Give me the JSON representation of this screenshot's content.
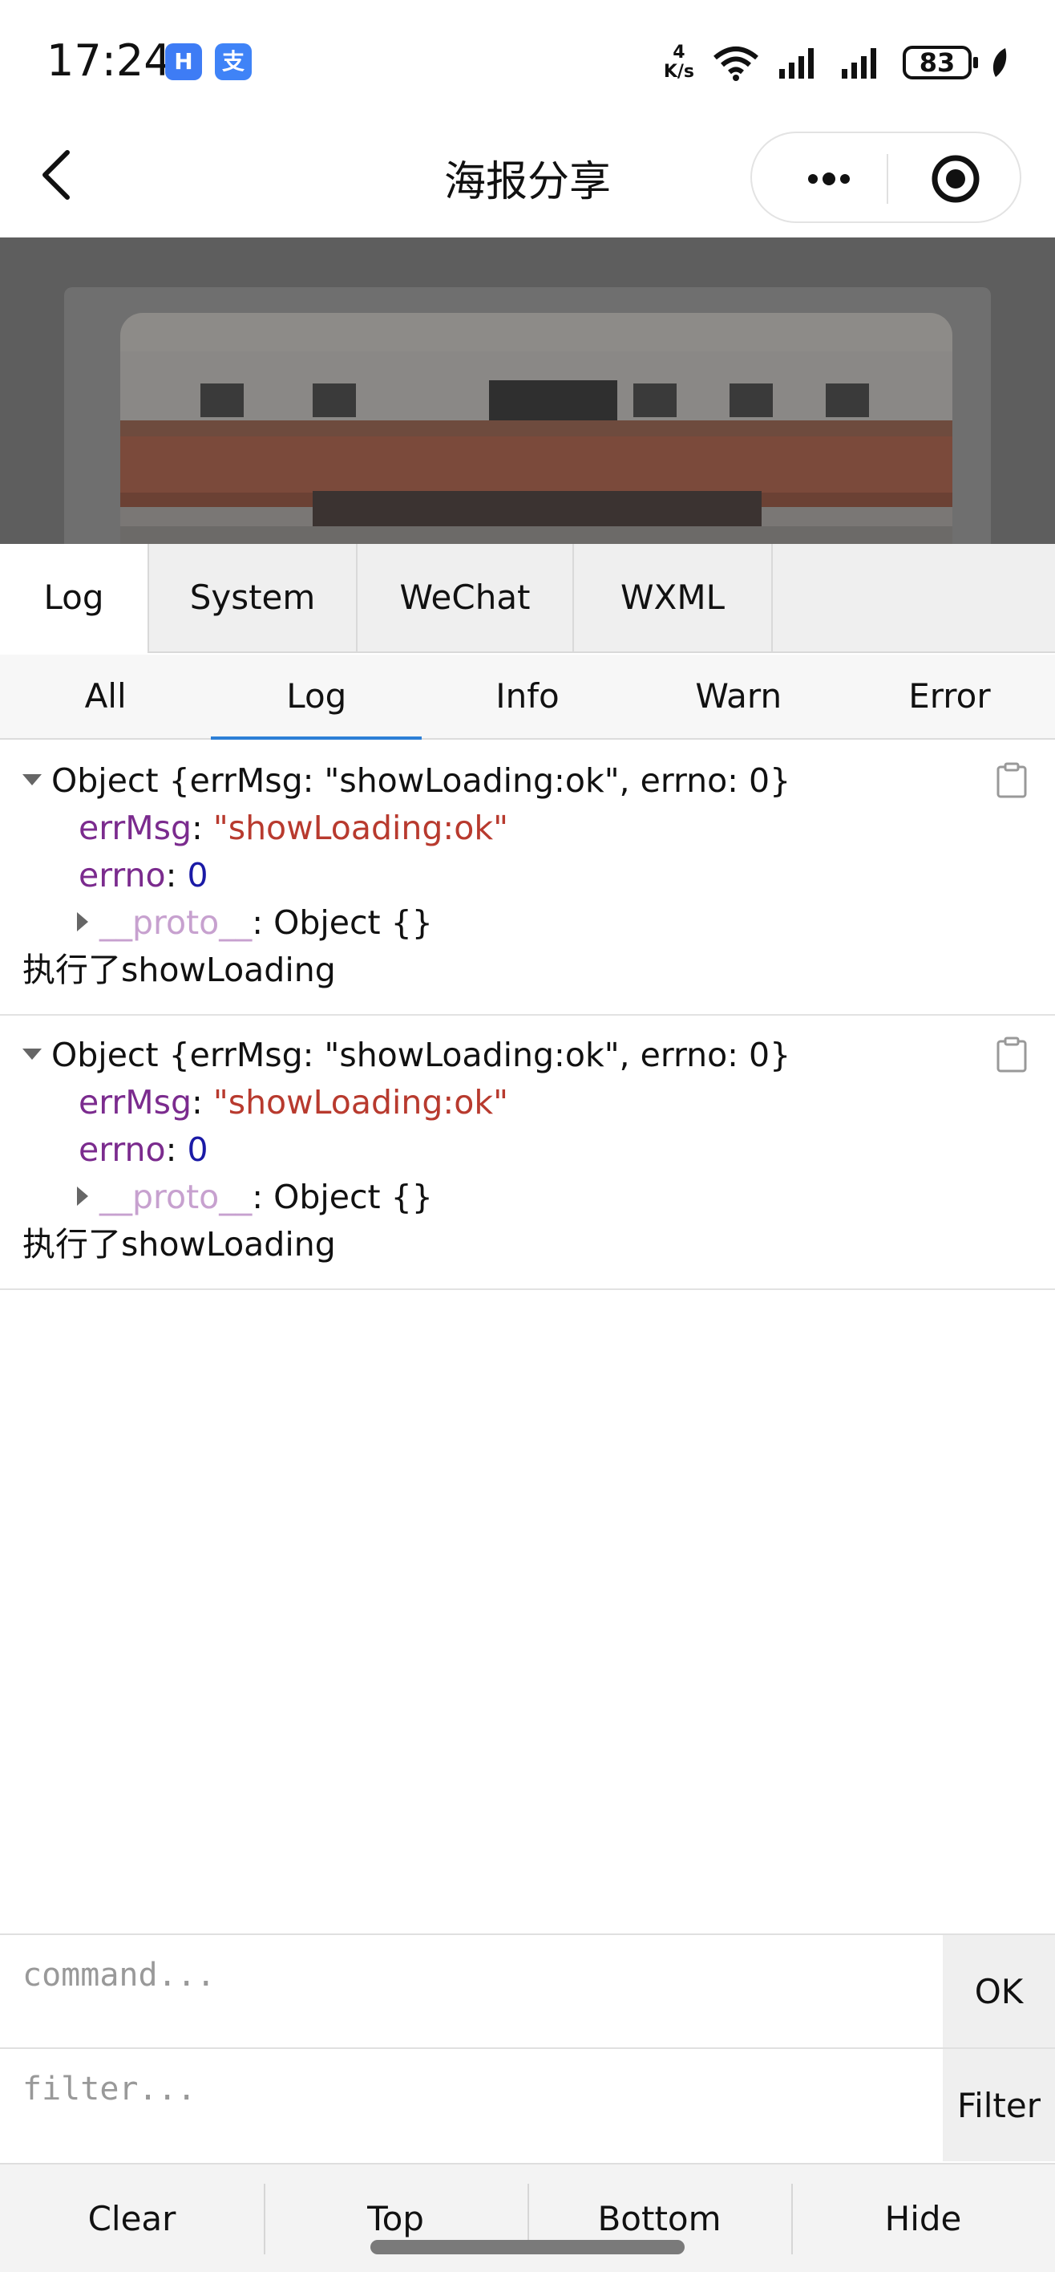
{
  "status_bar": {
    "time": "17:24",
    "badges": [
      "H",
      "支"
    ],
    "net_speed_top": "4",
    "net_speed_bottom": "K/s",
    "battery": "83"
  },
  "nav": {
    "title": "海报分享",
    "icons": [
      "back-chevron-icon",
      "more-dots-icon",
      "close-circle-icon"
    ]
  },
  "vconsole": {
    "tabs": [
      {
        "label": "Log"
      },
      {
        "label": "System"
      },
      {
        "label": "WeChat"
      },
      {
        "label": "WXML"
      }
    ],
    "subtabs": [
      {
        "label": "All"
      },
      {
        "label": "Log"
      },
      {
        "label": "Info"
      },
      {
        "label": "Warn"
      },
      {
        "label": "Error"
      }
    ],
    "active_subtab": "Log",
    "logs": [
      {
        "summary": "Object {errMsg: \"showLoading:ok\", errno: 0}",
        "errmsg_key": "errMsg",
        "errmsg_value": "\"showLoading:ok\"",
        "errno_key": "errno",
        "errno_value": "0",
        "proto_key": "__proto__",
        "proto_value": ": Object {}",
        "message": "执行了showLoading"
      },
      {
        "summary": "Object {errMsg: \"showLoading:ok\", errno: 0}",
        "errmsg_key": "errMsg",
        "errmsg_value": "\"showLoading:ok\"",
        "errno_key": "errno",
        "errno_value": "0",
        "proto_key": "__proto__",
        "proto_value": ": Object {}",
        "message": "执行了showLoading"
      }
    ],
    "command_placeholder": "command...",
    "command_button": "OK",
    "filter_placeholder": "filter...",
    "filter_button": "Filter",
    "toolbar": [
      "Clear",
      "Top",
      "Bottom",
      "Hide"
    ]
  },
  "colors": {
    "active_tab_underline": "#2d7fd6",
    "string_value": "#b83a2e",
    "number_value": "#1a1aa6",
    "key": "#7b2b8e"
  }
}
